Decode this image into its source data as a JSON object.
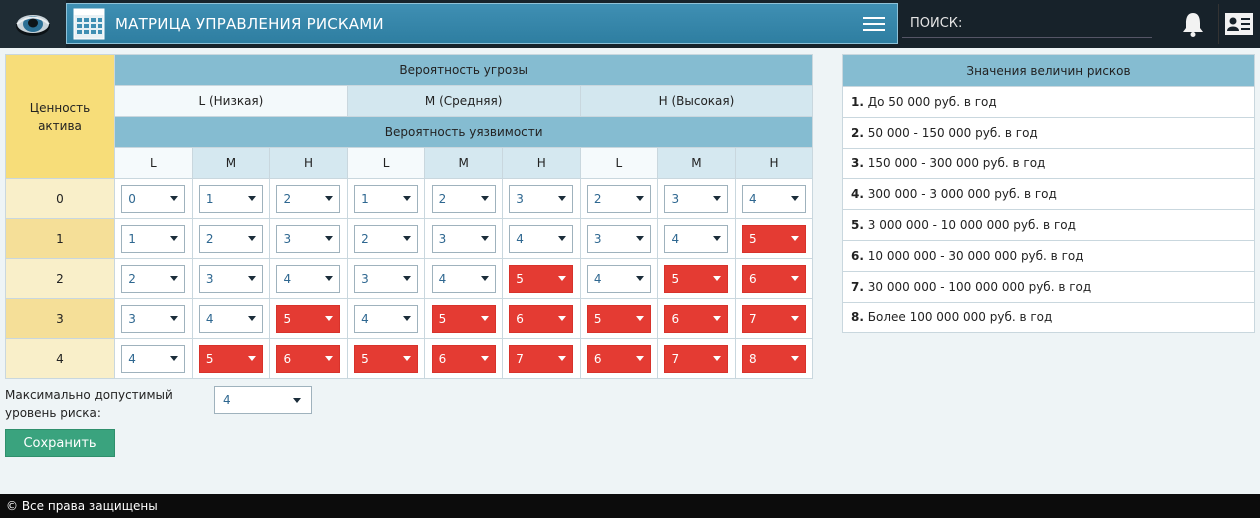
{
  "header": {
    "title": "МАТРИЦА УПРАВЛЕНИЯ РИСКАМИ",
    "search_placeholder": "ПОИСК:",
    "logo_icon": "eye-icon",
    "title_icon": "calendar-grid-icon",
    "menu_icon": "hamburger-icon",
    "bell_icon": "bell-icon",
    "profile_icon": "id-card-icon"
  },
  "matrix": {
    "corner_label": "Ценность актива",
    "threat_header": "Вероятность угрозы",
    "threat_levels": [
      "L (Низкая)",
      "M (Средняя)",
      "H (Высокая)"
    ],
    "vuln_header": "Вероятность уязвимости",
    "vuln_levels": [
      "L",
      "M",
      "H",
      "L",
      "M",
      "H",
      "L",
      "M",
      "H"
    ],
    "rows": [
      {
        "label": "0",
        "values": [
          "0",
          "1",
          "2",
          "1",
          "2",
          "3",
          "2",
          "3",
          "4"
        ]
      },
      {
        "label": "1",
        "values": [
          "1",
          "2",
          "3",
          "2",
          "3",
          "4",
          "3",
          "4",
          "5"
        ]
      },
      {
        "label": "2",
        "values": [
          "2",
          "3",
          "4",
          "3",
          "4",
          "5",
          "4",
          "5",
          "6"
        ]
      },
      {
        "label": "3",
        "values": [
          "3",
          "4",
          "5",
          "4",
          "5",
          "6",
          "5",
          "6",
          "7"
        ]
      },
      {
        "label": "4",
        "values": [
          "4",
          "5",
          "6",
          "5",
          "6",
          "7",
          "6",
          "7",
          "8"
        ]
      }
    ]
  },
  "legend": {
    "title": "Значения величин рисков",
    "items": [
      {
        "num": "1.",
        "text": "До 50 000 руб. в год"
      },
      {
        "num": "2.",
        "text": "50 000 - 150 000 руб. в год"
      },
      {
        "num": "3.",
        "text": "150 000 - 300 000 руб. в год"
      },
      {
        "num": "4.",
        "text": "300 000 - 3 000 000 руб. в год"
      },
      {
        "num": "5.",
        "text": "3 000 000 - 10 000 000 руб. в год"
      },
      {
        "num": "6.",
        "text": "10 000 000 - 30 000 000 руб. в год"
      },
      {
        "num": "7.",
        "text": "30 000 000 - 100 000 000 руб. в год"
      },
      {
        "num": "8.",
        "text": "Более 100 000 000 руб. в год"
      }
    ]
  },
  "max_level": {
    "label": "Максимально допустимый уровень риска:",
    "value": "4"
  },
  "save_label": "Сохранить",
  "footer": "© Все права защищены",
  "colors": {
    "over_limit": "#e43b33",
    "header_blue": "#3f8fb3",
    "corner_yellow": "#f7dd79",
    "save_green": "#3aa37e"
  }
}
